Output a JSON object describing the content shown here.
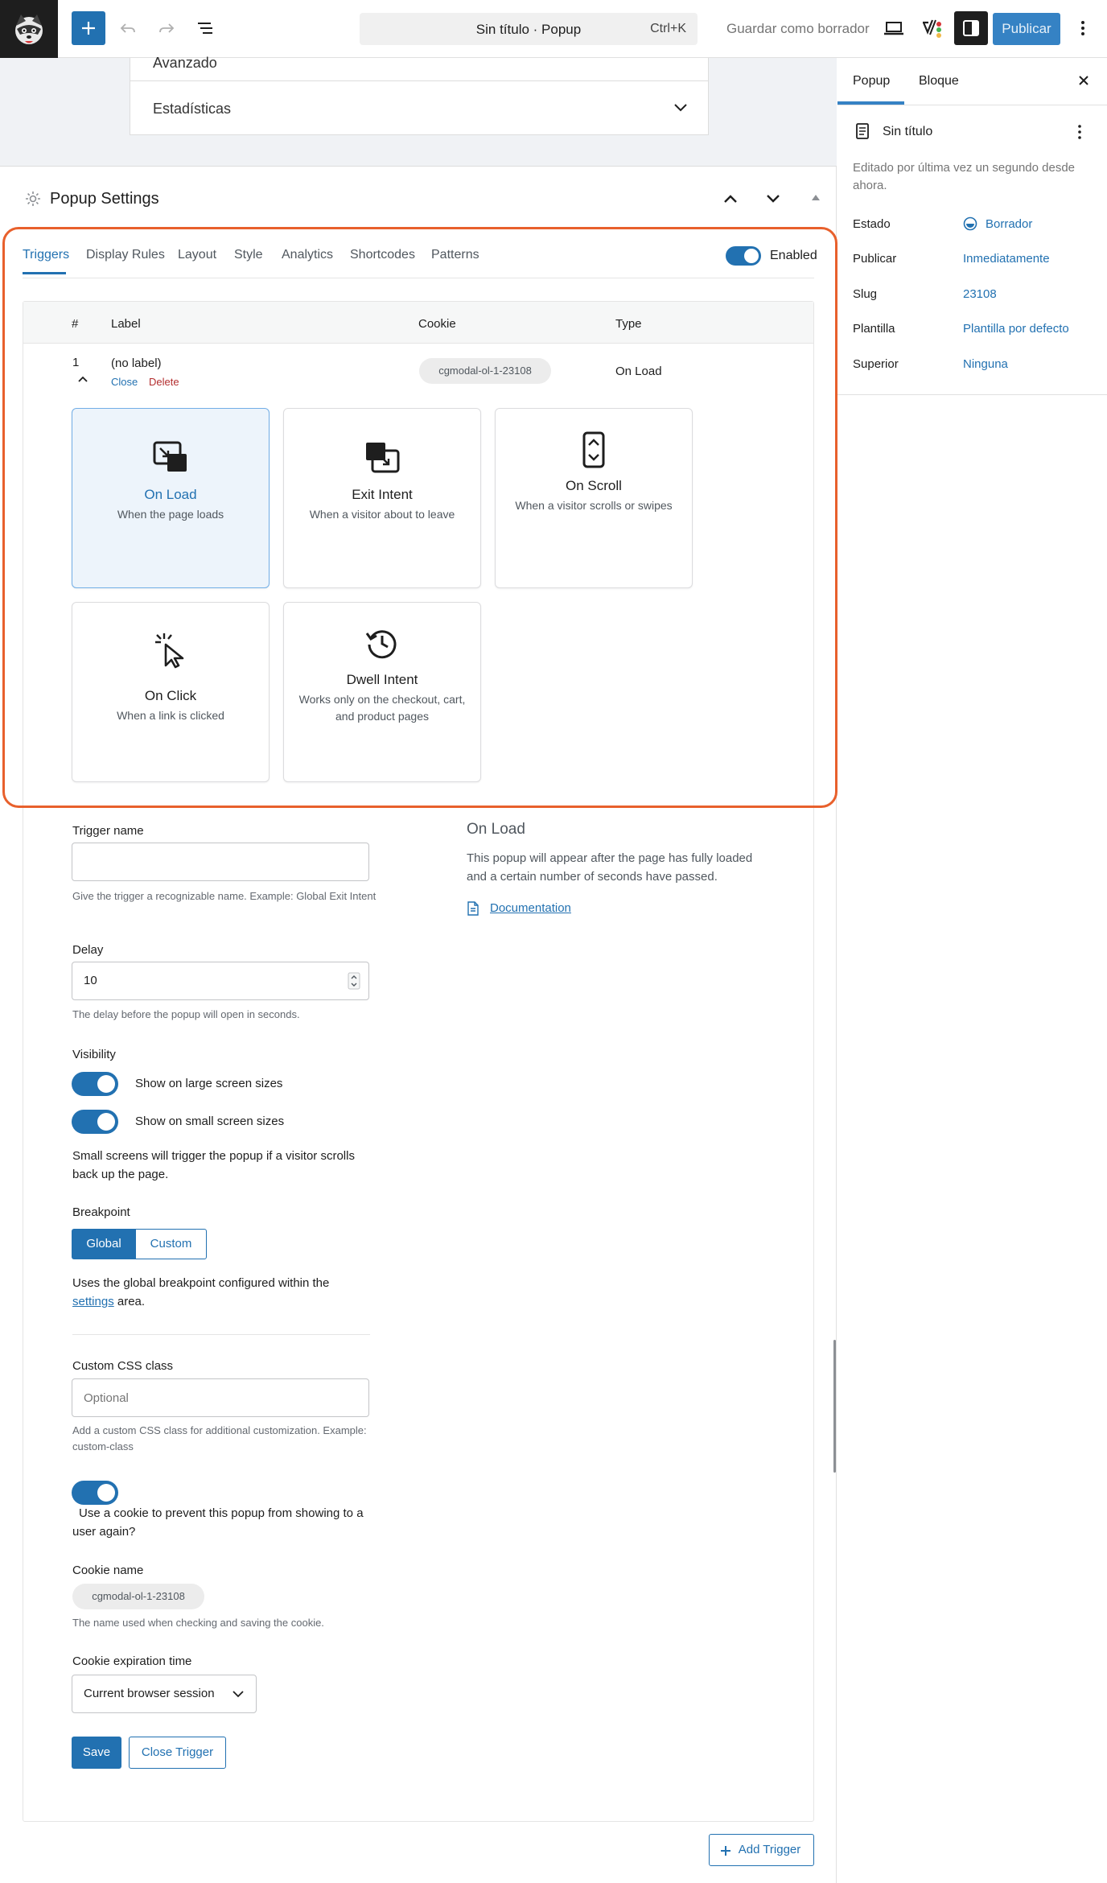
{
  "topbar": {
    "command_title": "Sin título · Popup",
    "command_shortcut": "Ctrl+K",
    "save_draft": "Guardar como borrador",
    "publish": "Publicar"
  },
  "canvas": {
    "prev_section": "Avanzado",
    "stats_section": "Estadísticas",
    "popup_settings_title": "Popup Settings"
  },
  "tabs": [
    "Triggers",
    "Display Rules",
    "Layout",
    "Style",
    "Analytics",
    "Shortcodes",
    "Patterns"
  ],
  "enabled_label": "Enabled",
  "table": {
    "headers": [
      "#",
      "Label",
      "Cookie",
      "Type"
    ],
    "row": {
      "num": "1",
      "label": "(no label)",
      "close": "Close",
      "delete": "Delete",
      "cookie": "cgmodal-ol-1-23108",
      "type": "On Load"
    }
  },
  "triggers": [
    {
      "title": "On Load",
      "desc": "When the page loads",
      "icon": "on-load-icon",
      "selected": true
    },
    {
      "title": "Exit Intent",
      "desc": "When a visitor about to leave",
      "icon": "exit-intent-icon"
    },
    {
      "title": "On Scroll",
      "desc": "When a visitor scrolls or swipes",
      "icon": "on-scroll-icon"
    },
    {
      "title": "On Click",
      "desc": "When a link is clicked",
      "icon": "on-click-icon"
    },
    {
      "title": "Dwell Intent",
      "desc": "Works only on the checkout, cart, and product pages",
      "icon": "dwell-intent-icon"
    }
  ],
  "form": {
    "trigger_name_label": "Trigger name",
    "trigger_name_value": "",
    "trigger_name_help": "Give the trigger a recognizable name. Example: Global Exit Intent",
    "delay_label": "Delay",
    "delay_value": "10",
    "delay_help": "The delay before the popup will open in seconds.",
    "visibility_label": "Visibility",
    "show_large": "Show on large screen sizes",
    "show_small": "Show on small screen sizes",
    "small_note": "Small screens will trigger the popup if a visitor scrolls back up the page.",
    "breakpoint_label": "Breakpoint",
    "breakpoint_global": "Global",
    "breakpoint_custom": "Custom",
    "breakpoint_note_pre": "Uses the global breakpoint configured within the",
    "breakpoint_note_link": "settings",
    "breakpoint_note_post": "area.",
    "css_label": "Custom CSS class",
    "css_placeholder": "Optional",
    "css_help": "Add a custom CSS class for additional customization. Example: custom-class",
    "cookie_toggle_label": "Use a cookie to prevent this popup from showing to a user again?",
    "cookie_name_label": "Cookie name",
    "cookie_name_value": "cgmodal-ol-1-23108",
    "cookie_name_help": "The name used when checking and saving the cookie.",
    "cookie_exp_label": "Cookie expiration time",
    "cookie_exp_value": "Current browser session",
    "save": "Save",
    "close_trigger": "Close Trigger",
    "add_trigger": "Add Trigger"
  },
  "info": {
    "title": "On Load",
    "desc": "This popup will appear after the page has fully loaded and a certain number of seconds have passed.",
    "doc_link": "Documentation"
  },
  "sidebar": {
    "tab_popup": "Popup",
    "tab_block": "Bloque",
    "doc_title": "Sin título",
    "edited": "Editado por última vez un segundo desde ahora.",
    "rows": [
      {
        "label": "Estado",
        "value": "Borrador"
      },
      {
        "label": "Publicar",
        "value": "Inmediatamente"
      },
      {
        "label": "Slug",
        "value": "23108"
      },
      {
        "label": "Plantilla",
        "value": "Plantilla por defecto"
      },
      {
        "label": "Superior",
        "value": "Ninguna"
      }
    ]
  }
}
